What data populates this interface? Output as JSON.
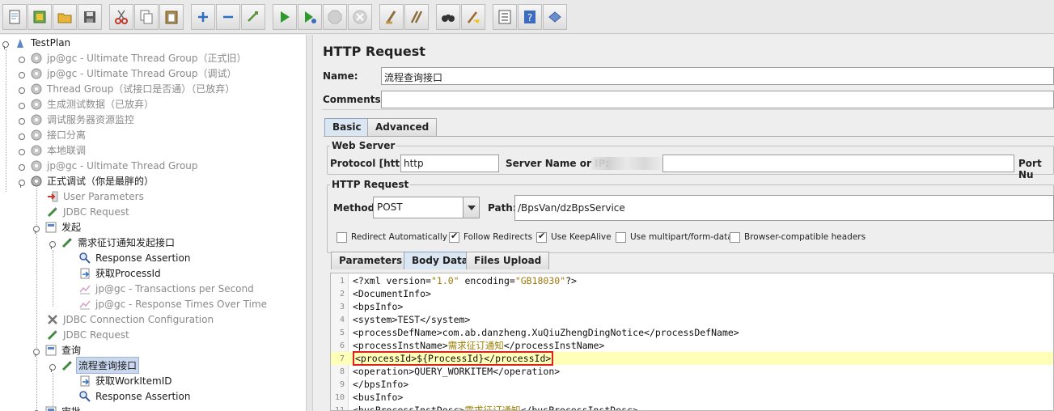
{
  "toolbar": {
    "buttons": [
      "new-icon",
      "templates-icon",
      "open-icon",
      "save-icon",
      "cut-icon",
      "copy-icon",
      "paste-icon",
      "expand-icon",
      "collapse-icon",
      "toggle-icon",
      "start-icon",
      "start-no-pause-icon",
      "stop-icon",
      "shutdown-icon",
      "clear-icon",
      "clear-all-icon",
      "search-icon",
      "reset-search-icon",
      "function-helper-icon",
      "help-icon",
      "remote-icon"
    ]
  },
  "tree": {
    "items": [
      {
        "label": "TestPlan",
        "enabled": true
      },
      {
        "label": "jp@gc - Ultimate Thread Group（正式旧）",
        "enabled": false
      },
      {
        "label": "jp@gc - Ultimate Thread Group（调试）",
        "enabled": false
      },
      {
        "label": "Thread Group（试接口是否通）（已放弃）",
        "enabled": false
      },
      {
        "label": "生成测试数据（已放弃）",
        "enabled": false
      },
      {
        "label": "调试服务器资源监控",
        "enabled": false
      },
      {
        "label": "接口分离",
        "enabled": false
      },
      {
        "label": "本地联调",
        "enabled": false
      },
      {
        "label": "jp@gc - Ultimate Thread Group",
        "enabled": false
      },
      {
        "label": "正式调试（你是最胖的）",
        "enabled": true
      },
      {
        "label": "User Parameters",
        "enabled": false
      },
      {
        "label": "JDBC Request",
        "enabled": false
      },
      {
        "label": "发起",
        "enabled": true
      },
      {
        "label": "需求征订通知发起接口",
        "enabled": true
      },
      {
        "label": "Response Assertion",
        "enabled": true
      },
      {
        "label": "获取ProcessId",
        "enabled": true
      },
      {
        "label": "jp@gc - Transactions per Second",
        "enabled": false
      },
      {
        "label": "jp@gc - Response Times Over Time",
        "enabled": false
      },
      {
        "label": "JDBC Connection Configuration",
        "enabled": false
      },
      {
        "label": "JDBC Request",
        "enabled": false
      },
      {
        "label": "查询",
        "enabled": true
      },
      {
        "label": "流程查询接口",
        "enabled": true
      },
      {
        "label": "获取WorkItemID",
        "enabled": true
      },
      {
        "label": "Response Assertion",
        "enabled": true
      },
      {
        "label": "审批",
        "enabled": true
      }
    ]
  },
  "panel": {
    "title": "HTTP Request",
    "name_label": "Name:",
    "name_value": "流程查询接口",
    "comments_label": "Comments:",
    "comments_value": "",
    "tabs": [
      "Basic",
      "Advanced"
    ],
    "web_server": {
      "title": "Web Server",
      "protocol_label": "Protocol [http]:",
      "protocol_value": "http",
      "server_label": "Server Name or IP:",
      "port_label": "Port Nu"
    },
    "http_request": {
      "title": "HTTP Request",
      "method_label": "Method:",
      "method_value": "POST",
      "path_label": "Path:",
      "path_value": "/BpsVan/dzBpsService"
    },
    "options": [
      {
        "label": "Redirect Automatically",
        "checked": false
      },
      {
        "label": "Follow Redirects",
        "checked": true
      },
      {
        "label": "Use KeepAlive",
        "checked": true
      },
      {
        "label": "Use multipart/form-data",
        "checked": false
      },
      {
        "label": "Browser-compatible headers",
        "checked": false
      }
    ],
    "body_tabs": [
      "Parameters",
      "Body Data",
      "Files Upload"
    ]
  },
  "code": [
    {
      "n": "1",
      "parts": [
        [
          "tag",
          "<?xml version="
        ],
        [
          "str",
          "\"1.0\""
        ],
        [
          "tag",
          " encoding="
        ],
        [
          "str",
          "\"GB18030\""
        ],
        [
          "tag",
          "?>"
        ]
      ]
    },
    {
      "n": "2",
      "parts": [
        [
          "tag",
          "<DocumentInfo>"
        ]
      ]
    },
    {
      "n": "3",
      "parts": [
        [
          "tag",
          "<bpsInfo>"
        ]
      ]
    },
    {
      "n": "4",
      "parts": [
        [
          "tag",
          "<system>TEST</system>"
        ]
      ]
    },
    {
      "n": "5",
      "parts": [
        [
          "tag",
          "<processDefName>com.ab.danzheng.XuQiuZhengDingNotice</processDefName>"
        ]
      ]
    },
    {
      "n": "6",
      "parts": [
        [
          "tag",
          "<processInstName>"
        ],
        [
          "cn",
          "需求征订通知"
        ],
        [
          "tag",
          "</processInstName>"
        ]
      ]
    },
    {
      "n": "7",
      "parts": [
        [
          "tag",
          "<processId>${ProcessId}</processId>"
        ]
      ],
      "highlight": true
    },
    {
      "n": "8",
      "parts": [
        [
          "tag",
          "<operation>QUERY_WORKITEM</operation>"
        ]
      ]
    },
    {
      "n": "9",
      "parts": [
        [
          "tag",
          "</bpsInfo>"
        ]
      ]
    },
    {
      "n": "10",
      "parts": [
        [
          "tag",
          "<busInfo>"
        ]
      ]
    },
    {
      "n": "11",
      "parts": [
        [
          "tag",
          "<busProcessInstDesc>"
        ],
        [
          "cn",
          "需求征订通知"
        ],
        [
          "tag",
          "</busProcessInstDesc>"
        ]
      ]
    }
  ]
}
